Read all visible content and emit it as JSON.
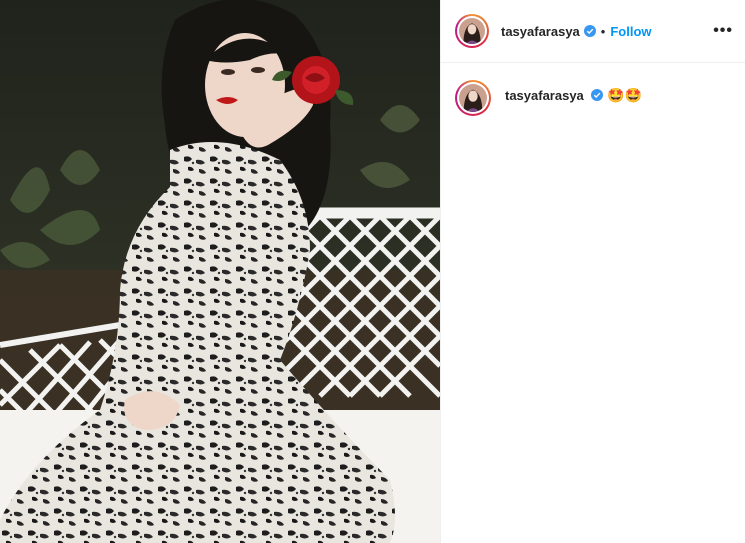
{
  "post": {
    "username": "tasyafarasya",
    "verified": true,
    "follow_label": "Follow",
    "separator": "•",
    "more_label": "•••"
  },
  "caption": {
    "username": "tasyafarasya",
    "text": "🤩🤩"
  },
  "colors": {
    "accent": "#0095f6",
    "verified": "#3897f0",
    "text": "#262626",
    "divider": "#efefef"
  },
  "photo": {
    "subject": "woman in black and white patterned dress with red rose in hair, seated on white lattice bench"
  }
}
